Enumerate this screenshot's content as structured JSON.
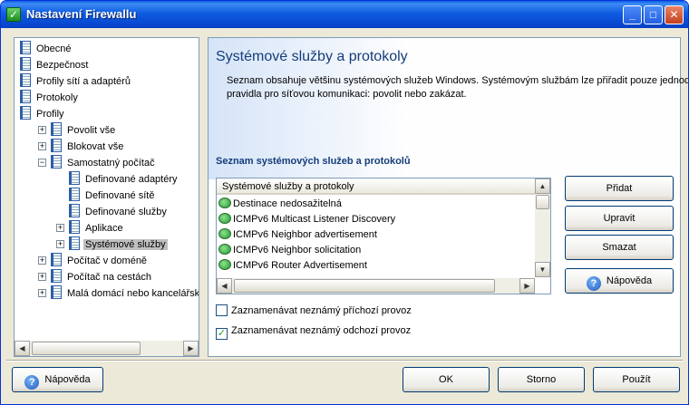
{
  "window": {
    "title": "Nastavení Firewallu",
    "app_icon": "check-shield-icon",
    "controls": [
      "minimize-icon",
      "maximize-icon",
      "close-icon"
    ]
  },
  "tree": [
    {
      "label": "Obecné",
      "depth": 0,
      "expandable": false,
      "selected": false
    },
    {
      "label": "Bezpečnost",
      "depth": 0,
      "expandable": false,
      "selected": false
    },
    {
      "label": "Profily sítí a adaptérů",
      "depth": 0,
      "expandable": false,
      "selected": false
    },
    {
      "label": "Protokoly",
      "depth": 0,
      "expandable": false,
      "selected": false
    },
    {
      "label": "Profily",
      "depth": 0,
      "expandable": false,
      "selected": false
    },
    {
      "label": "Povolit vše",
      "depth": 1,
      "expandable": true,
      "expanded": false,
      "selected": false
    },
    {
      "label": "Blokovat vše",
      "depth": 1,
      "expandable": true,
      "expanded": false,
      "selected": false
    },
    {
      "label": "Samostatný počítač",
      "depth": 1,
      "expandable": true,
      "expanded": true,
      "selected": false
    },
    {
      "label": "Definované adaptéry",
      "depth": 2,
      "expandable": false,
      "selected": false
    },
    {
      "label": "Definované sítě",
      "depth": 2,
      "expandable": false,
      "selected": false
    },
    {
      "label": "Definované služby",
      "depth": 2,
      "expandable": false,
      "selected": false
    },
    {
      "label": "Aplikace",
      "depth": 2,
      "expandable": true,
      "expanded": false,
      "selected": false
    },
    {
      "label": "Systémové služby",
      "depth": 2,
      "expandable": true,
      "expanded": false,
      "selected": true
    },
    {
      "label": "Počítač v doméně",
      "depth": 1,
      "expandable": true,
      "expanded": false,
      "selected": false
    },
    {
      "label": "Počítač na cestách",
      "depth": 1,
      "expandable": true,
      "expanded": false,
      "selected": false
    },
    {
      "label": "Malá domácí nebo kancelářská síť",
      "depth": 1,
      "expandable": true,
      "expanded": false,
      "selected": false
    }
  ],
  "main": {
    "title": "Systémové služby a protokoly",
    "description": "Seznam obsahuje většinu systémových služeb Windows. Systémovým službám lze přiřadit pouze jednodu pravidla pro síťovou komunikaci: povolit nebo zakázat.",
    "section_title": "Seznam systémových služeb a protokolů",
    "list_header": "Systémové služby a protokoly",
    "list_items": [
      "Destinace nedosažitelná",
      "ICMPv6 Multicast Listener Discovery",
      "ICMPv6 Neighbor advertisement",
      "ICMPv6 Neighbor solicitation",
      "ICMPv6 Router Advertisement"
    ],
    "buttons": {
      "add": "Přidat",
      "edit": "Upravit",
      "delete": "Smazat",
      "help": "Nápověda"
    },
    "checkboxes": [
      {
        "label": "Zaznamenávat neznámý příchozí provoz",
        "checked": false
      },
      {
        "label": "Zaznamenávat neznámý odchozí provoz",
        "checked": true
      }
    ]
  },
  "footer": {
    "help": "Nápověda",
    "ok": "OK",
    "cancel": "Storno",
    "apply": "Použít"
  }
}
